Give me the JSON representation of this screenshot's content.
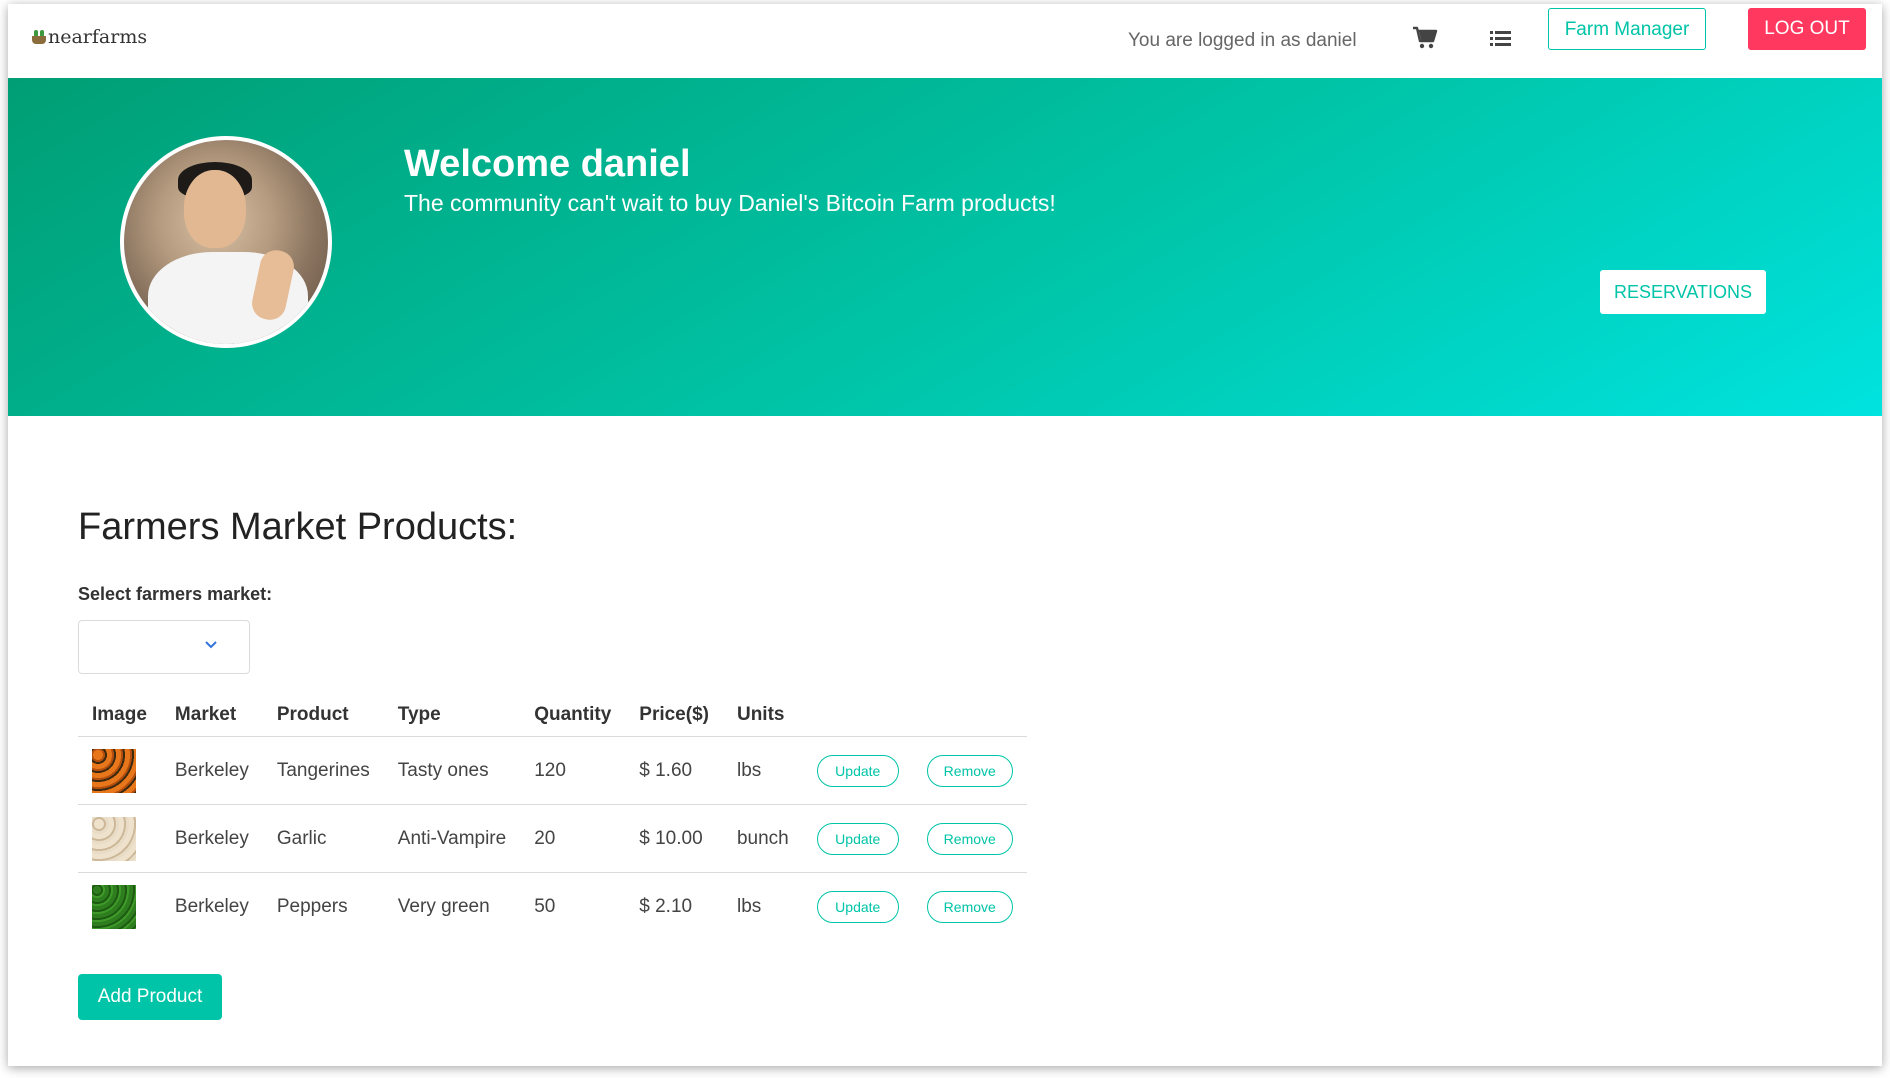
{
  "navbar": {
    "brand": "nearfarms",
    "logged_in_text": "You are logged in as daniel",
    "farm_manager_label": "Farm Manager",
    "logout_label": "LOG OUT"
  },
  "hero": {
    "welcome": "Welcome daniel",
    "subtitle": "The community can't wait to buy Daniel's Bitcoin Farm products!",
    "reservations_label": "RESERVATIONS"
  },
  "products": {
    "title": "Farmers Market Products:",
    "select_label": "Select farmers market:",
    "selected_market": "",
    "columns": [
      "Image",
      "Market",
      "Product",
      "Type",
      "Quantity",
      "Price($)",
      "Units"
    ],
    "rows": [
      {
        "market": "Berkeley",
        "product": "Tangerines",
        "type": "Tasty ones",
        "quantity": "120",
        "price": "$ 1.60",
        "units": "lbs",
        "update": "Update",
        "remove": "Remove"
      },
      {
        "market": "Berkeley",
        "product": "Garlic",
        "type": "Anti-Vampire",
        "quantity": "20",
        "price": "$ 10.00",
        "units": "bunch",
        "update": "Update",
        "remove": "Remove"
      },
      {
        "market": "Berkeley",
        "product": "Peppers",
        "type": "Very green",
        "quantity": "50",
        "price": "$ 2.10",
        "units": "lbs",
        "update": "Update",
        "remove": "Remove"
      }
    ],
    "add_label": "Add Product"
  },
  "colors": {
    "accent": "#00c4a7",
    "danger": "#ff3860",
    "hero_start": "#009e74",
    "hero_end": "#00e3df"
  }
}
